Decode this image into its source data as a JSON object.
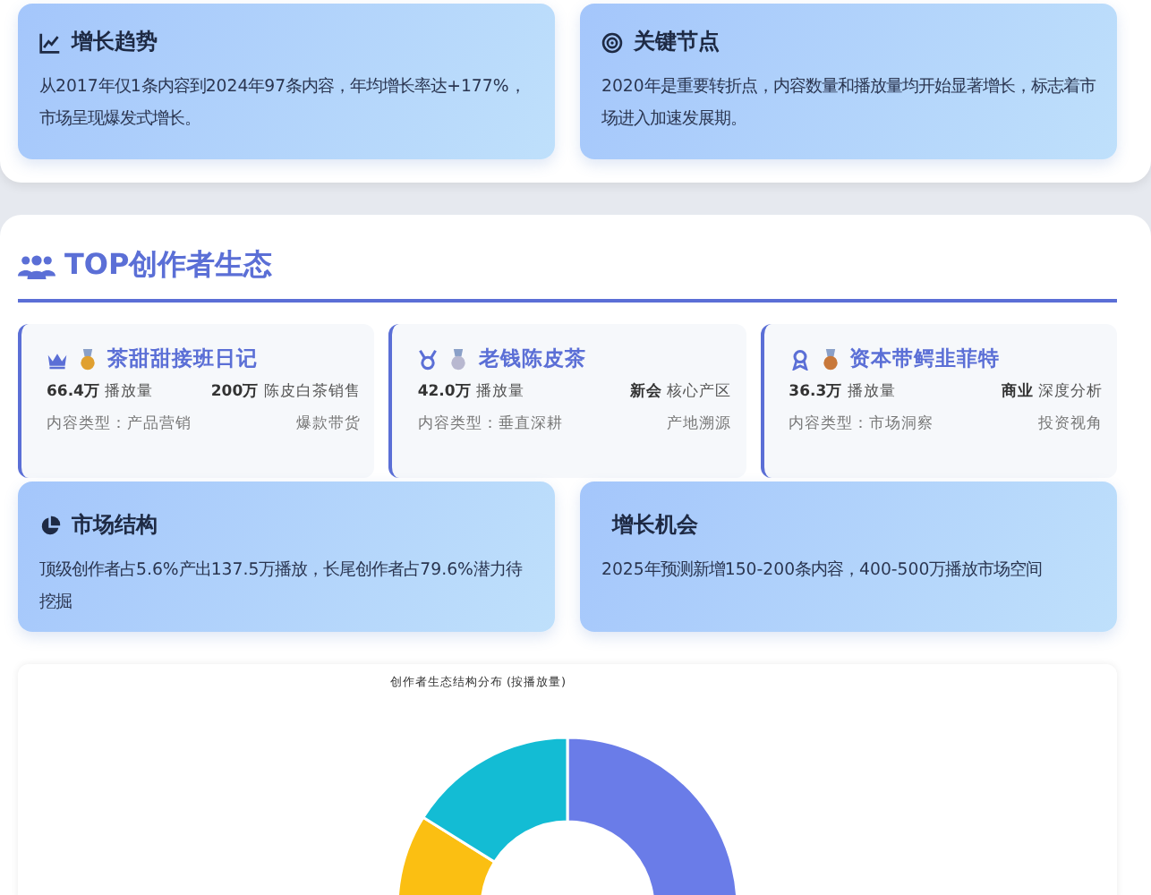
{
  "insights_top": [
    {
      "title": "增长趋势",
      "text": "从2017年仅1条内容到2024年97条内容，年均增长率达+177%，市场呈现爆发式增长。"
    },
    {
      "title": "关键节点",
      "text": "2020年是重要转折点，内容数量和播放量均开始显著增长，标志着市场进入加速发展期。"
    }
  ],
  "section": {
    "title": "TOP创作者生态",
    "creators": [
      {
        "name": "茶甜甜接班日记",
        "color": "#e0a030",
        "plays": "66.4万",
        "plays_label": "播放量",
        "stat": "200万",
        "stat_label": "陈皮白茶销售",
        "type": "内容类型：产品营销",
        "tag": "爆款带货"
      },
      {
        "name": "老钱陈皮茶",
        "color": "#b8b8d0",
        "plays": "42.0万",
        "plays_label": "播放量",
        "stat": "新会",
        "stat_label": "核心产区",
        "type": "内容类型：垂直深耕",
        "tag": "产地溯源"
      },
      {
        "name": "资本带鳄韭菲特",
        "color": "#c8783a",
        "plays": "36.3万",
        "plays_label": "播放量",
        "stat": "商业",
        "stat_label": "深度分析",
        "type": "内容类型：市场洞察",
        "tag": "投资视角"
      }
    ],
    "insights": [
      {
        "title": "市场结构",
        "text": "顶级创作者占5.6%产出137.5万播放，长尾创作者占79.6%潜力待挖掘"
      },
      {
        "title": "增长机会",
        "text": "2025年预测新增150-200条内容，400-500万播放市场空间"
      }
    ],
    "chart": {
      "title": "创作者生态结构分布 (按播放量)"
    }
  }
}
